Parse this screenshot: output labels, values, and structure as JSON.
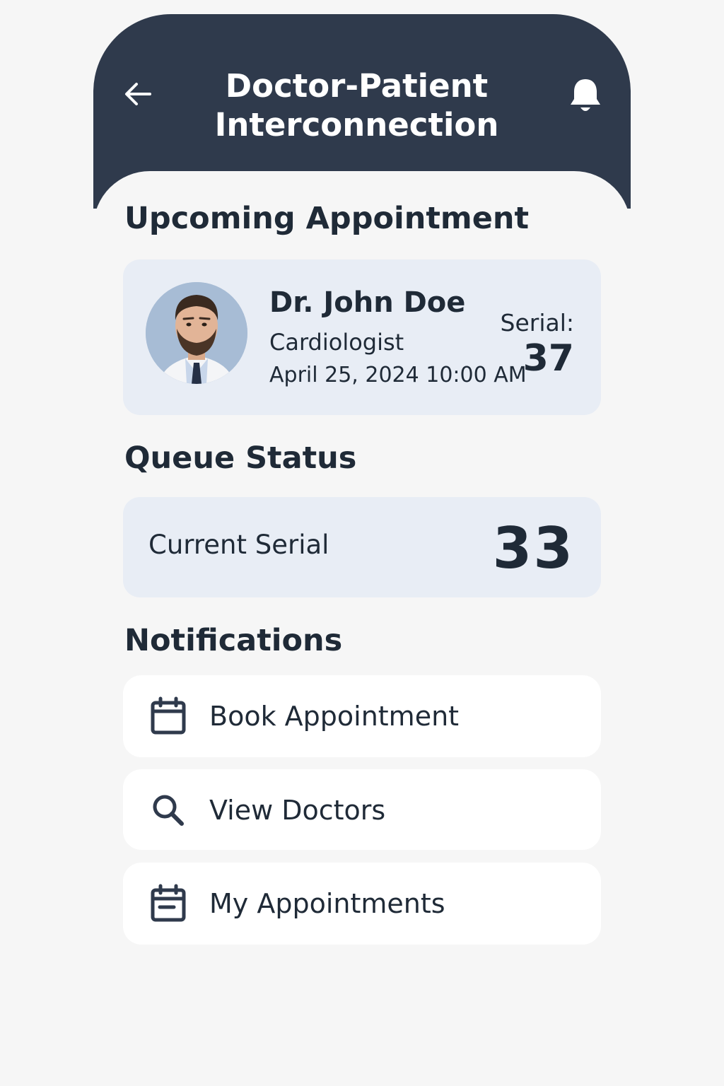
{
  "header": {
    "title_line1": "Doctor-Patient",
    "title_line2": "Interconnection",
    "back_icon": "arrow-left-icon",
    "bell_icon": "bell-icon"
  },
  "upcoming": {
    "section_title": "Upcoming Appointment",
    "doctor_name": "Dr. John Doe",
    "specialty": "Cardiologist",
    "date_time": "April 25, 2024 10:00 AM",
    "serial_label": "Serial:",
    "serial_value": "37"
  },
  "queue": {
    "section_title": "Queue Status",
    "label": "Current Serial",
    "value": "33"
  },
  "notifications": {
    "section_title": "Notifications",
    "items": [
      {
        "label": "Book Appointment",
        "icon": "calendar-icon"
      },
      {
        "label": "View Doctors",
        "icon": "search-icon"
      },
      {
        "label": "My Appointments",
        "icon": "calendar-event-icon"
      }
    ]
  },
  "colors": {
    "header_bg": "#2f3a4c",
    "card_bg": "#e8edf5",
    "text": "#1f2a37",
    "page_bg": "#f6f6f6"
  }
}
